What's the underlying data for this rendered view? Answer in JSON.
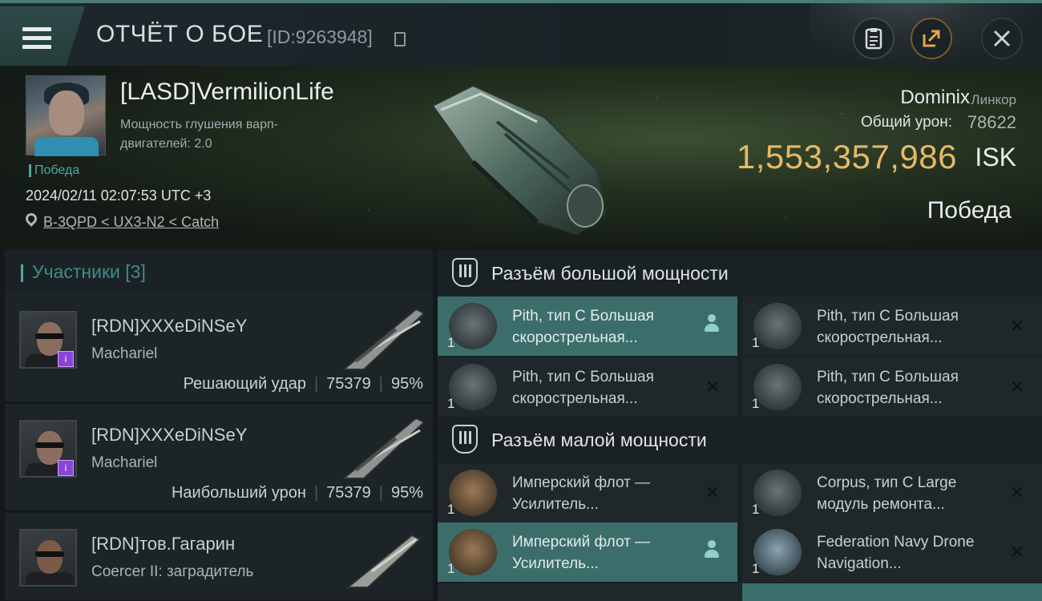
{
  "header": {
    "title": "ОТЧЁТ О БОЕ",
    "report_id": "[ID:9263948]"
  },
  "victim": {
    "pilot_name": "[LASD]VermilionLife",
    "stat": "Мощность глушения варп-двигателей: 2.0",
    "victory_tag": "Победа",
    "datetime": "2024/02/11 02:07:53 UTC +3",
    "location": "B-3QPD < UX3-N2 < Catch",
    "ship_name": "Dominix",
    "ship_class": "Линкор",
    "damage_label": "Общий урон:",
    "damage_value": "78622",
    "isk_value": "1,553,357,986",
    "isk_unit": "ISK",
    "result": "Победа"
  },
  "participants": {
    "title": "Участники [3]",
    "rows": [
      {
        "name": "[RDN]XXXeDiNSeY",
        "ship": "Machariel",
        "role": "Решающий удар",
        "damage": "75379",
        "percent": "95%"
      },
      {
        "name": "[RDN]XXXeDiNSeY",
        "ship": "Machariel",
        "role": "Наибольший урон",
        "damage": "75379",
        "percent": "95%"
      },
      {
        "name": "[RDN]тов.Гагарин",
        "ship": "Coercer II: заградитель",
        "role": "",
        "damage": "",
        "percent": ""
      }
    ]
  },
  "modules": {
    "high_slot_title": "Разъём большой мощности",
    "low_slot_title": "Разъём малой мощности",
    "high": [
      {
        "name": "Pith, тип C Большая скорострельная...",
        "qty": "1",
        "selected": true,
        "mark": "person"
      },
      {
        "name": "Pith, тип C Большая скорострельная...",
        "qty": "1",
        "selected": false,
        "mark": "x"
      },
      {
        "name": "Pith, тип C Большая скорострельная...",
        "qty": "1",
        "selected": false,
        "mark": "x"
      },
      {
        "name": "Pith, тип C Большая скорострельная...",
        "qty": "1",
        "selected": false,
        "mark": "x"
      }
    ],
    "low": [
      {
        "name": "Имперский флот — Усилитель...",
        "qty": "1",
        "selected": false,
        "mark": "x"
      },
      {
        "name": "Corpus, тип C Large модуль ремонта...",
        "qty": "1",
        "selected": false,
        "mark": "x"
      },
      {
        "name": "Имперский флот — Усилитель...",
        "qty": "1",
        "selected": true,
        "mark": "person"
      },
      {
        "name": "Federation Navy Drone Navigation...",
        "qty": "1",
        "selected": false,
        "mark": "x"
      }
    ]
  },
  "icons": {
    "menu": "hamburger-icon",
    "copy": "copy-icon",
    "clipboard": "clipboard-icon",
    "share": "share-icon",
    "close": "close-icon",
    "location": "location-pin-icon",
    "slot": "slot-icon"
  },
  "colors": {
    "accent_teal": "#4fa7a0",
    "isk_gold": "#e7b866",
    "selected_row": "#3b6e6b",
    "share_orange": "#e3a453",
    "badge_purple": "#8a45d6"
  }
}
